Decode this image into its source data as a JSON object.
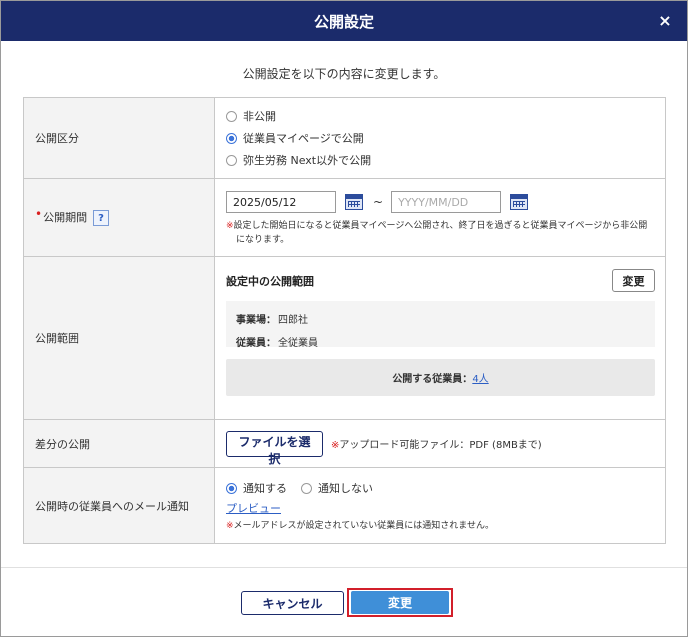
{
  "dialog": {
    "title": "公開設定",
    "close": "×",
    "intro": "公開設定を以下の内容に変更します。"
  },
  "rows": {
    "category": {
      "label": "公開区分",
      "options": [
        "非公開",
        "従業員マイページで公開",
        "弥生労務 Next以外で公開"
      ],
      "selected_index": 1
    },
    "period": {
      "required_mark": "•",
      "label": "公開期間",
      "help": "?",
      "start_value": "2025/05/12",
      "separator": "~",
      "end_placeholder": "YYYY/MM/DD",
      "note_mark": "※",
      "note": "設定した開始日になると従業員マイページへ公開され、終了日を過ぎると従業員マイページから非公開になります。"
    },
    "range": {
      "label": "公開範囲",
      "section_title": "設定中の公開範囲",
      "change_label": "変更",
      "office_label": "事業場：",
      "office_value": "四郎社",
      "employee_label": "従業員：",
      "employee_value": "全従業員",
      "count_label": "公開する従業員：",
      "count_value": "4人"
    },
    "diff": {
      "label": "差分の公開",
      "file_button": "ファイルを選択",
      "note_mark": "※",
      "note": "アップロード可能ファイル：PDF (8MBまで)"
    },
    "mail": {
      "label": "公開時の従業員へのメール通知",
      "options": [
        "通知する",
        "通知しない"
      ],
      "selected_index": 0,
      "preview_label": "プレビュー",
      "note_mark": "※",
      "note": "メールアドレスが設定されていない従業員には通知されません。"
    }
  },
  "footer": {
    "cancel_label": "キャンセル",
    "submit_label": "変更"
  },
  "colors": {
    "header": "#1b2b6b",
    "accent": "#3f8fd8",
    "highlight": "#d21f2a",
    "required": "#d92020"
  }
}
